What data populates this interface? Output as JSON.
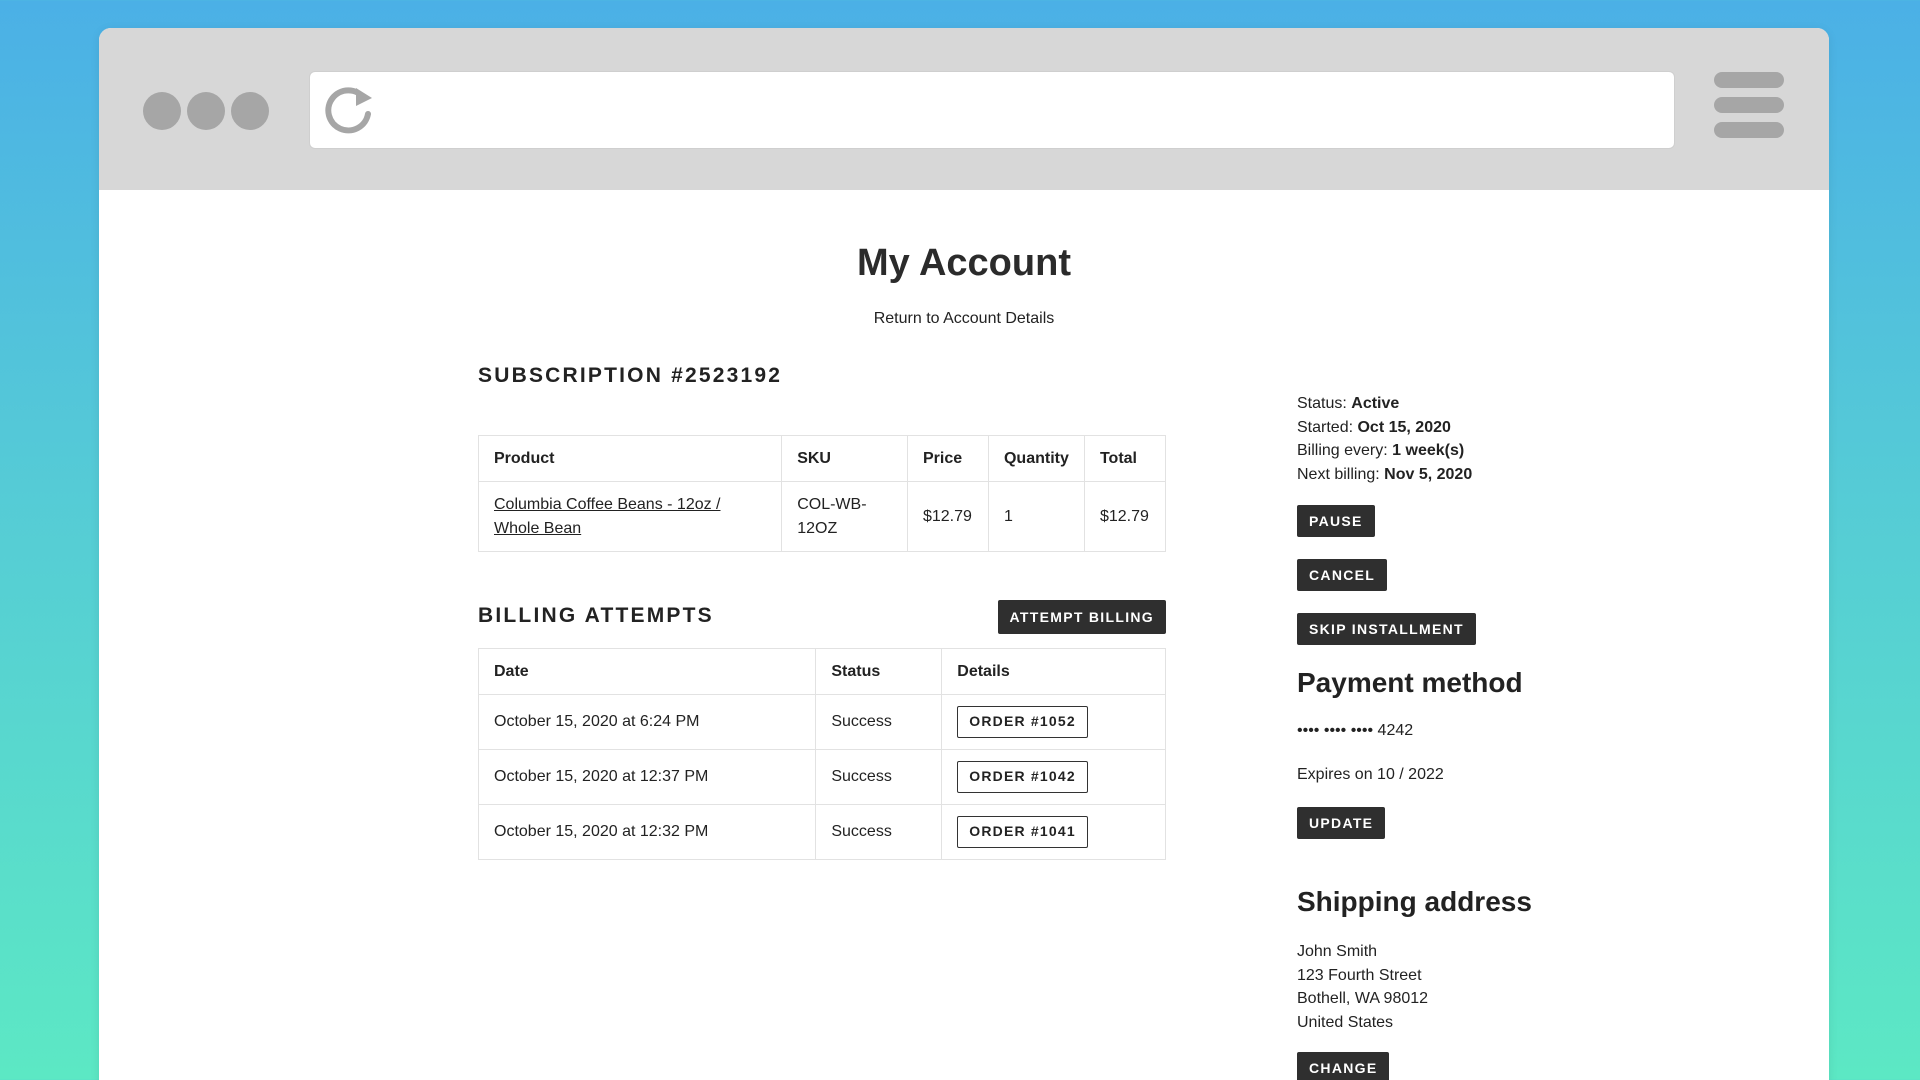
{
  "page": {
    "title": "My Account",
    "return_link": "Return to Account Details"
  },
  "subscription": {
    "title": "SUBSCRIPTION #2523192",
    "headers": [
      "Product",
      "SKU",
      "Price",
      "Quantity",
      "Total"
    ],
    "rows": [
      {
        "product_line1": "Columbia Coffee Beans - 12oz /",
        "product_line2": "Whole Bean",
        "sku_line1": "COL-WB-",
        "sku_line2": "12OZ",
        "price": "$12.79",
        "quantity": "1",
        "total": "$12.79"
      }
    ]
  },
  "billing": {
    "title": "BILLING ATTEMPTS",
    "attempt_button": "ATTEMPT BILLING",
    "headers": [
      "Date",
      "Status",
      "Details"
    ],
    "rows": [
      {
        "date": "October 15, 2020 at 6:24 PM",
        "status": "Success",
        "order": "ORDER #1052"
      },
      {
        "date": "October 15, 2020 at 12:37 PM",
        "status": "Success",
        "order": "ORDER #1042"
      },
      {
        "date": "October 15, 2020 at 12:32 PM",
        "status": "Success",
        "order": "ORDER #1041"
      }
    ]
  },
  "details": {
    "status_label": "Status:",
    "status_value": "Active",
    "started_label": "Started:",
    "started_value": "Oct 15, 2020",
    "billing_label": "Billing every:",
    "billing_value": "1 week(s)",
    "next_label": "Next billing:",
    "next_value": "Nov 5, 2020",
    "pause_button": "PAUSE",
    "cancel_button": "CANCEL",
    "skip_button": "SKIP INSTALLMENT"
  },
  "payment": {
    "title": "Payment method",
    "card": "•••• •••• •••• 4242",
    "expires": "Expires on 10 / 2022",
    "update_button": "UPDATE"
  },
  "shipping": {
    "title": "Shipping address",
    "name": "John Smith",
    "street": "123 Fourth Street",
    "city": "Bothell, WA 98012",
    "country": "United States",
    "change_button": "CHANGE"
  },
  "icons": {
    "reload": "reload-icon",
    "menu": "hamburger-menu-icon"
  },
  "colors": {
    "background_top": "#4bb0e6",
    "background_bottom": "#5ce8c4",
    "chrome": "#d7d7d7",
    "button_dark": "#2f2f2f"
  }
}
